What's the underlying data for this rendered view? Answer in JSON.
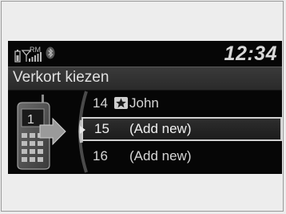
{
  "status": {
    "clock": "12:34",
    "icons": [
      "battery-icon",
      "signal-icon",
      "roaming-icon",
      "bluetooth-icon"
    ],
    "roaming_label": "RM"
  },
  "title": "Verkort kiezen",
  "list": {
    "rows": [
      {
        "number": "14",
        "name": "John",
        "has_star": true
      },
      {
        "number": "15",
        "name": "(Add new)",
        "selected": true
      },
      {
        "number": "16",
        "name": "(Add new)"
      }
    ]
  },
  "colors": {
    "screen_bg": "#060606",
    "text": "#d5d5d5",
    "highlight_border": "#cfcfcf"
  }
}
